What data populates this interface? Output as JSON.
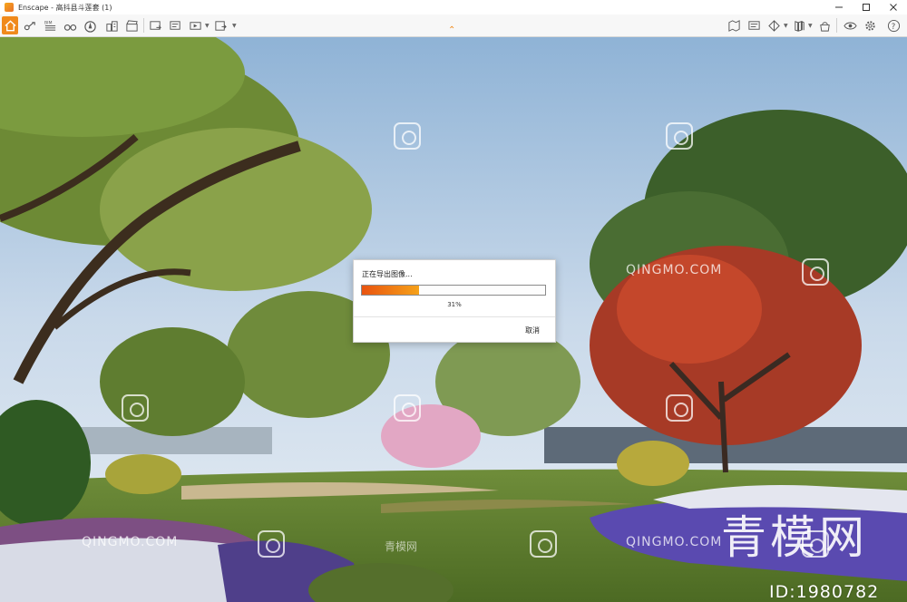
{
  "window": {
    "title": "Enscape - 高抖县斗莲套 (1)",
    "controls": [
      "minimize",
      "maximize",
      "close"
    ]
  },
  "toolbar": {
    "left_icons": [
      "home-icon",
      "walk-mode-icon",
      "bim-icon",
      "binoculars-icon",
      "north-compass-icon",
      "building-icon",
      "clapper-icon",
      "screenshot-export-icon",
      "batch-render-icon",
      "export-video-icon",
      "export-web-icon"
    ],
    "bim_label": "BIM",
    "right_icons": [
      "map-icon",
      "monitor-icon",
      "section-view-icon",
      "books-icon",
      "asset-library-icon",
      "visibility-icon",
      "settings-icon",
      "help-icon"
    ],
    "help_label": "?"
  },
  "dialog": {
    "title": "正在导出图像...",
    "progress": 0.31,
    "percent_label": "31%",
    "cancel_label": "取消"
  },
  "watermark": {
    "site_text": "QINGMO.COM",
    "site_cn": "青模网",
    "brand_big": "青模网",
    "id_label": "ID:1980782"
  },
  "colors": {
    "accent_orange": "#f08a1c",
    "progress_start": "#e9530f",
    "progress_end": "#f5a21a"
  }
}
